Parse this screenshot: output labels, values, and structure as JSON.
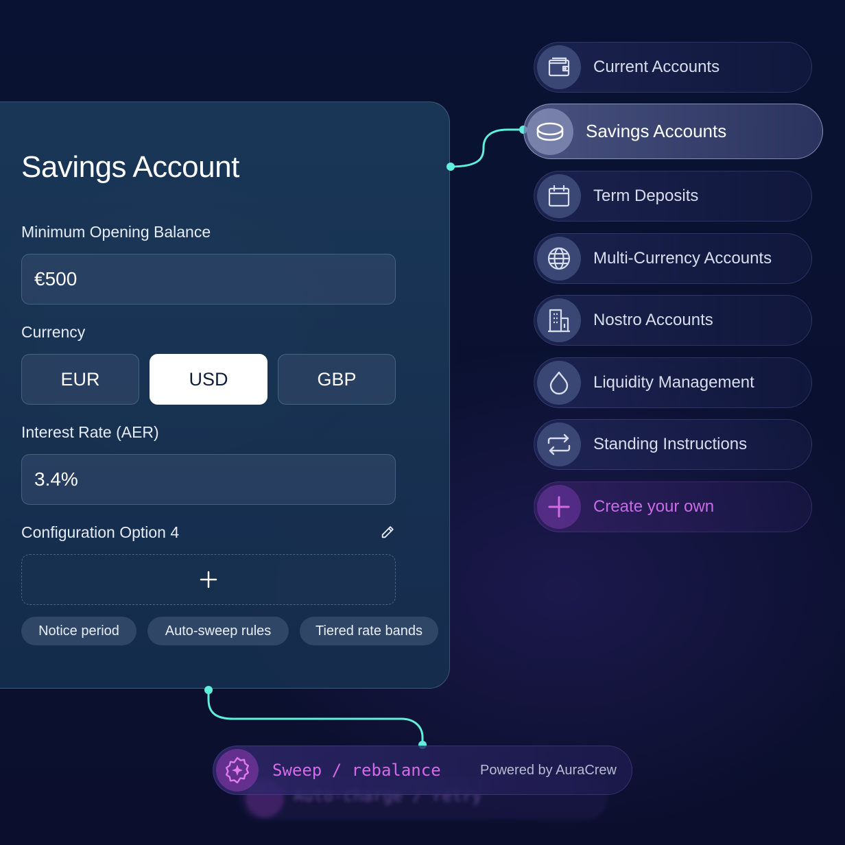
{
  "card": {
    "title": "Savings Account",
    "min_balance_label": "Minimum Opening Balance",
    "min_balance_value": "€500",
    "currency_label": "Currency",
    "currencies": [
      "EUR",
      "USD",
      "GBP"
    ],
    "selected_currency": "USD",
    "interest_label": "Interest Rate (AER)",
    "interest_value": "3.4%",
    "config_label": "Configuration Option 4",
    "add_symbol": "+",
    "chips": [
      "Notice period",
      "Auto-sweep rules",
      "Tiered rate bands"
    ]
  },
  "menu": {
    "items": [
      {
        "label": "Current Accounts",
        "icon": "wallet-icon"
      },
      {
        "label": "Savings Accounts",
        "icon": "coins-icon",
        "selected": true
      },
      {
        "label": "Term Deposits",
        "icon": "calendar-icon"
      },
      {
        "label": "Multi-Currency Accounts",
        "icon": "globe-icon"
      },
      {
        "label": "Nostro Accounts",
        "icon": "building-icon"
      },
      {
        "label": "Liquidity Management",
        "icon": "droplet-icon"
      },
      {
        "label": "Standing Instructions",
        "icon": "repeat-icon"
      },
      {
        "label": "Create your own",
        "icon": "plus-icon"
      }
    ]
  },
  "sweep": {
    "text": "Sweep / rebalance",
    "powered_by": "Powered by AuraCrew",
    "ghost_text": "Auto-charge / retry"
  },
  "colors": {
    "accent_teal": "#5ff0dc",
    "accent_purple": "#d56ae8",
    "background": "#0a1233"
  }
}
